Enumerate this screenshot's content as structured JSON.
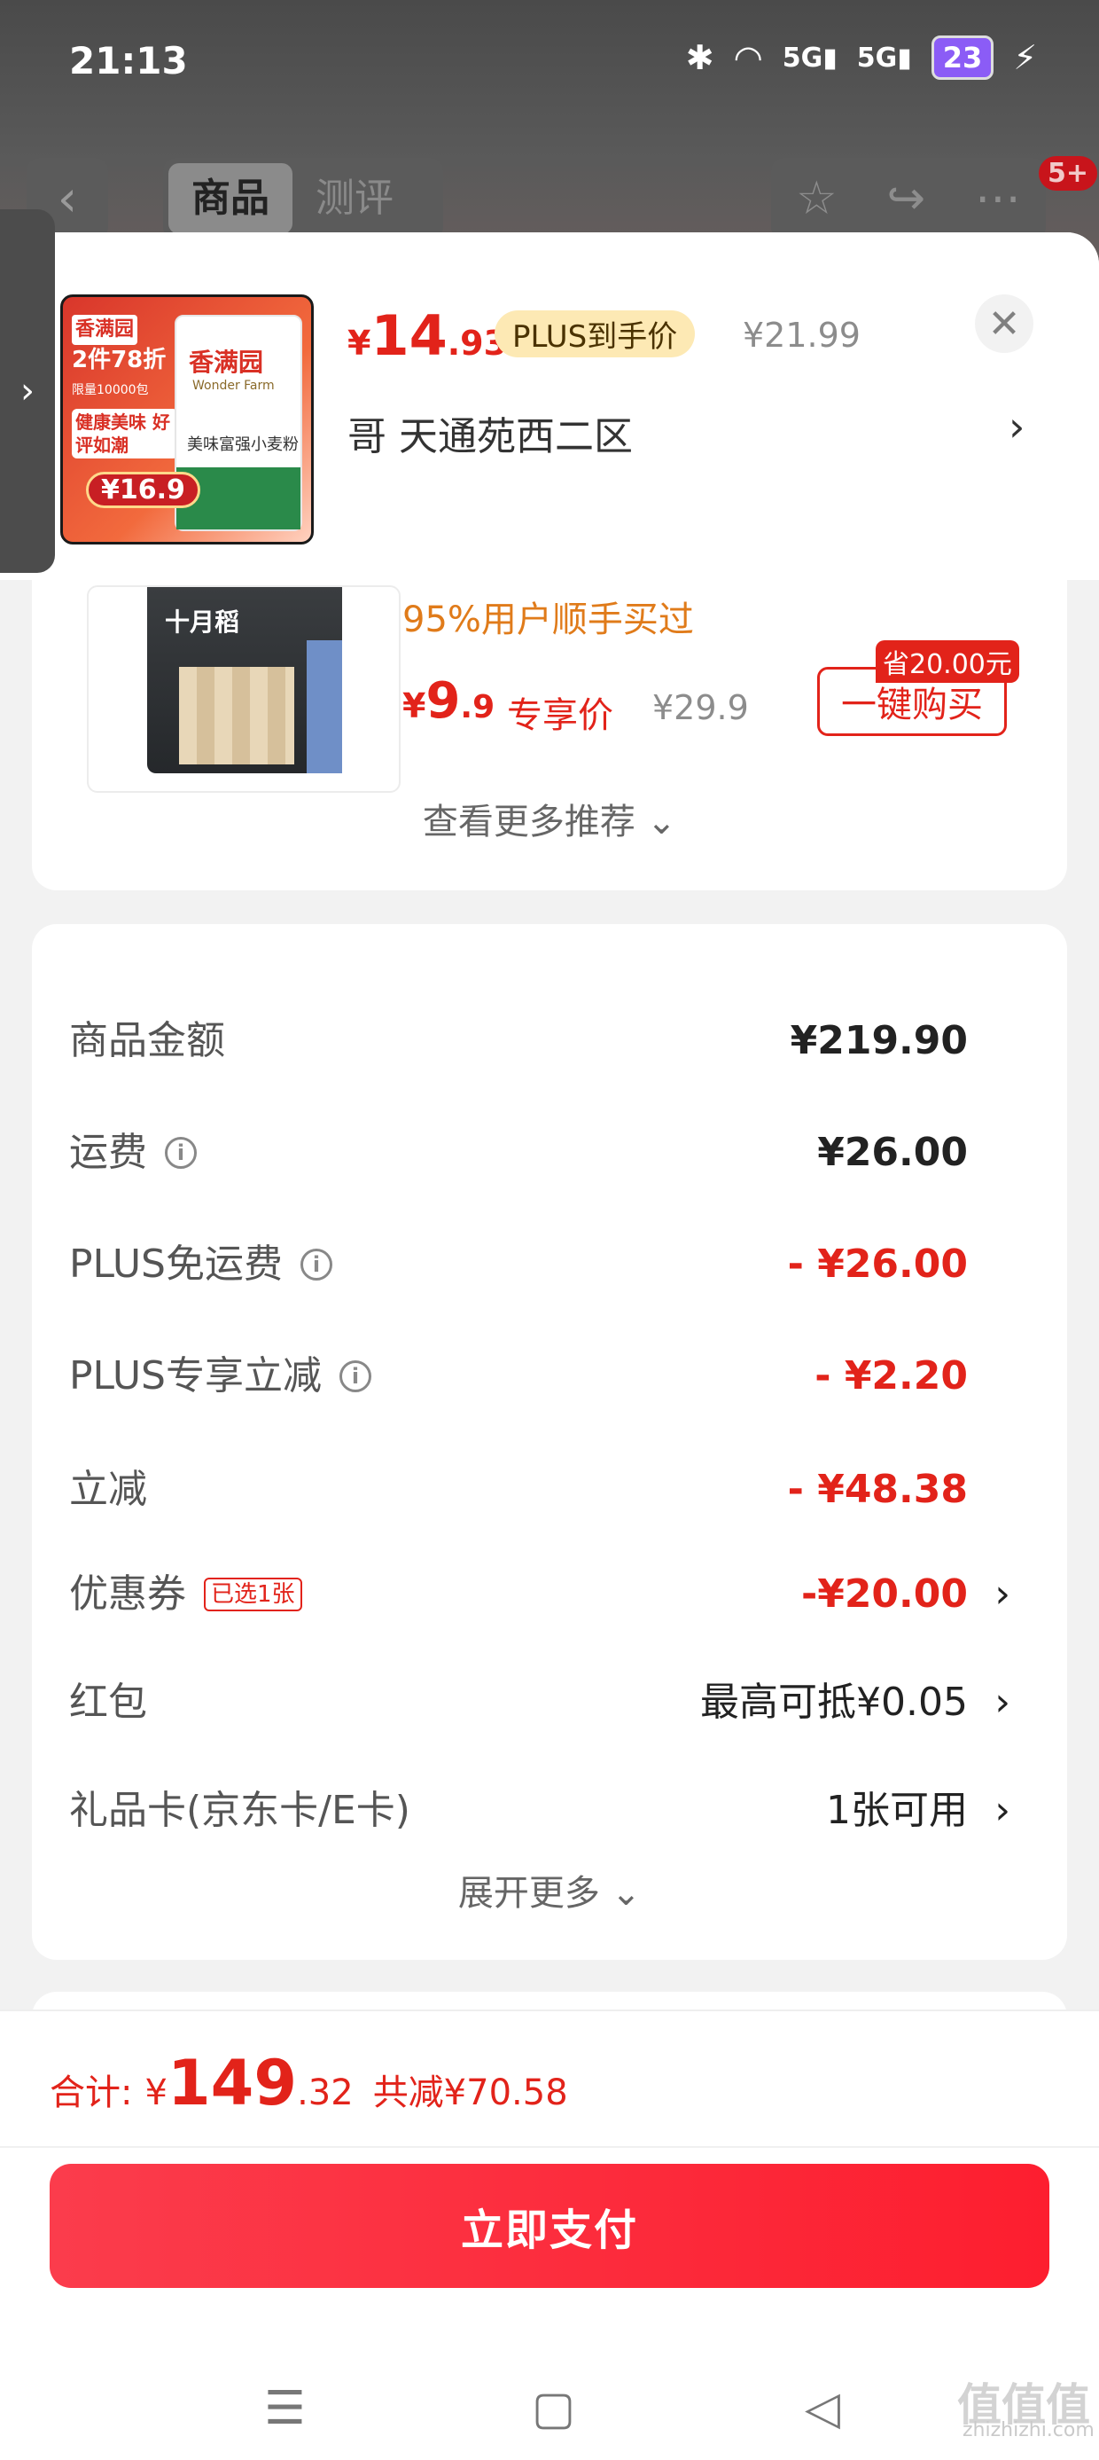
{
  "status_bar": {
    "time": "21:13",
    "battery": "23",
    "signal_1": "5G",
    "signal_2": "5G"
  },
  "background_page": {
    "back_icon": "chevron-left-icon",
    "tabs": [
      "商品",
      "测评"
    ],
    "actions": [
      "star-icon",
      "share-icon",
      "more-icon"
    ],
    "badge": "5+"
  },
  "product": {
    "image": {
      "brand": "香满园",
      "promo": "2件78折",
      "limit": "限量10000包",
      "slogan": "健康美味 好评如潮",
      "price_tag": "16.9",
      "bag_brand": "香满园",
      "bag_sub": "Wonder Farm",
      "bag_desc": "美味富强小麦粉"
    },
    "price_yen": "¥",
    "price_int": "14",
    "price_dec": ".93",
    "plus_label": "PLUS到手价",
    "original_price": "¥21.99",
    "address": "哥  天通苑西二区"
  },
  "recommend": {
    "thumb_title": "十月稻",
    "bought": "95%用户顺手买过",
    "price_yen": "¥",
    "price_int": "9",
    "price_dec": ".9",
    "exclusive": "专享价",
    "original": "¥29.9",
    "save_tag": "省20.00元",
    "buy_button": "一键购买",
    "more": "查看更多推荐"
  },
  "summary": {
    "rows": [
      {
        "label": "商品金额",
        "value": "¥219.90"
      },
      {
        "label": "运费",
        "value": "¥26.00"
      },
      {
        "label": "PLUS免运费",
        "value": "- ¥26.00"
      },
      {
        "label": "PLUS专享立减",
        "value": "- ¥2.20"
      },
      {
        "label": "立减",
        "value": "- ¥48.38"
      },
      {
        "label": "优惠券",
        "badge": "已选1张",
        "value": "-¥20.00"
      },
      {
        "label": "红包",
        "value": "最高可抵¥0.05"
      },
      {
        "label": "礼品卡(京东卡/E卡)",
        "value": "1张可用"
      }
    ],
    "expand": "展开更多"
  },
  "footer": {
    "total_label": "合计:",
    "total_yen": "¥",
    "total_int": "149",
    "total_dec": ".32",
    "total_saved": "共减¥70.58",
    "pay_button": "立即支付"
  },
  "nav": [
    "menu-icon",
    "home-icon",
    "back-icon"
  ],
  "watermark": {
    "big": "值值值",
    "small": "zhizhizhi.com"
  },
  "colors": {
    "accent": "#e2231a",
    "plus_pill": "#fde9b4",
    "bought": "#e07b1a"
  }
}
